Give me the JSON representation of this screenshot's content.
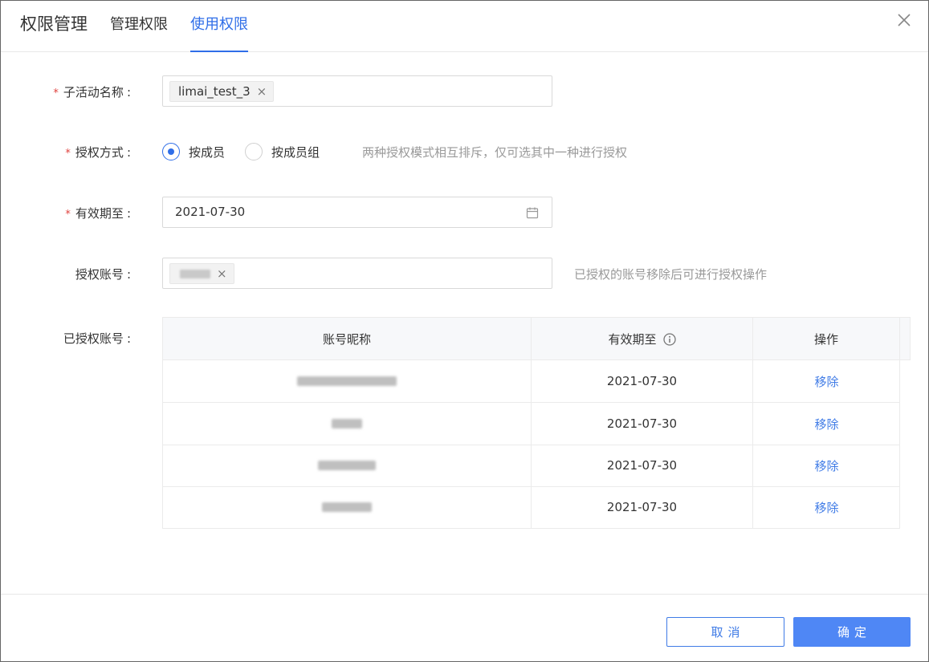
{
  "header": {
    "title": "权限管理",
    "tabs": [
      {
        "label": "管理权限",
        "active": false
      },
      {
        "label": "使用权限",
        "active": true
      }
    ]
  },
  "form": {
    "sub_activity": {
      "label": "子活动名称",
      "required_mark": "*",
      "colon": ":",
      "tag": "limai_test_3",
      "tag_remove": "×"
    },
    "auth_mode": {
      "label": "授权方式",
      "required_mark": "*",
      "colon": ":",
      "options": [
        "按成员",
        "按成员组"
      ],
      "selected": "按成员",
      "hint": "两种授权模式相互排斥，仅可选其中一种进行授权"
    },
    "valid_until": {
      "label": "有效期至",
      "required_mark": "*",
      "colon": ":",
      "value": "2021-07-30"
    },
    "auth_account": {
      "label": "授权账号",
      "colon": ":",
      "tag_remove": "×",
      "hint": "已授权的账号移除后可进行授权操作"
    },
    "authorized_accounts": {
      "label": "已授权账号",
      "colon": ":"
    }
  },
  "table": {
    "columns": [
      "账号昵称",
      "有效期至",
      "操作"
    ],
    "rows": [
      {
        "expiry": "2021-07-30",
        "action": "移除"
      },
      {
        "expiry": "2021-07-30",
        "action": "移除"
      },
      {
        "expiry": "2021-07-30",
        "action": "移除"
      },
      {
        "expiry": "2021-07-30",
        "action": "移除"
      }
    ]
  },
  "footer": {
    "cancel_label": "取消",
    "ok_label": "确定"
  },
  "colors": {
    "accent": "#2f6ee8",
    "link": "#3f7be6",
    "primary_button": "#4f87f5",
    "required": "#e0433f"
  },
  "icons": {
    "close": "close-icon",
    "calendar": "calendar-icon",
    "info": "info-icon"
  }
}
